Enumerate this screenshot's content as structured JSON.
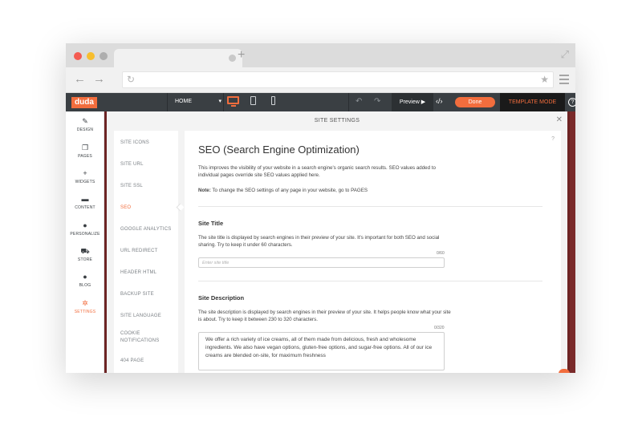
{
  "browser": {
    "window_dots": [
      "#f45b51",
      "#f7be2e",
      "#aeaeae"
    ],
    "new_tab_label": "+",
    "icons": [
      "back-arrow-icon",
      "forward-arrow-icon",
      "reload-icon",
      "star-icon",
      "menu-icon",
      "expand-icon"
    ]
  },
  "toolbar": {
    "logo": "duda",
    "page_select": "HOME",
    "preview_label": "Preview ▶",
    "done_label": "Done",
    "template_mode_label": "TEMPLATE MODE",
    "help_label": "?",
    "accent": "#f26d3d"
  },
  "sidebar": {
    "items": [
      {
        "label": "DESIGN",
        "icon": "brush-icon",
        "glyph": "✎"
      },
      {
        "label": "PAGES",
        "icon": "pages-icon",
        "glyph": "❐"
      },
      {
        "label": "WIDGETS",
        "icon": "plus-icon",
        "glyph": "+"
      },
      {
        "label": "CONTENT",
        "icon": "folder-icon",
        "glyph": "▬"
      },
      {
        "label": "PERSONALIZE",
        "icon": "person-icon",
        "glyph": "●"
      },
      {
        "label": "STORE",
        "icon": "cart-icon",
        "glyph": "⛟"
      },
      {
        "label": "BLOG",
        "icon": "chat-icon",
        "glyph": "●"
      },
      {
        "label": "SETTINGS",
        "icon": "gear-icon",
        "glyph": "✲",
        "active": true
      }
    ]
  },
  "modal": {
    "title": "SITE SETTINGS",
    "close_glyph": "✕",
    "help_glyph": "?",
    "menu": [
      {
        "label": "SITE ICONS"
      },
      {
        "label": "SITE URL"
      },
      {
        "label": "SITE SSL"
      },
      {
        "label": "SEO",
        "active": true
      },
      {
        "label": "GOOGLE ANALYTICS"
      },
      {
        "label": "URL REDIRECT"
      },
      {
        "label": "HEADER HTML"
      },
      {
        "label": "BACKUP SITE"
      },
      {
        "label": "SITE LANGUAGE"
      },
      {
        "label": "COOKIE NOTIFICATIONS"
      },
      {
        "label": "404 PAGE"
      }
    ]
  },
  "seo": {
    "heading": "SEO (Search Engine Optimization)",
    "intro": "This improves the visibility of your website in a search engine's organic search results. SEO values added to individual pages override site SEO values applied here.",
    "note_label": "Note:",
    "note_text": " To change the SEO settings of any page in your website, go to PAGES",
    "site_title": {
      "heading": "Site Title",
      "description": "The site title is displayed by search engines in their preview of your site. It's important for both SEO and social sharing. Try to keep it under 60 characters.",
      "counter": "0/60",
      "value": "",
      "placeholder": "Enter site title"
    },
    "site_description": {
      "heading": "Site Description",
      "description": "The site description is displayed by search engines in their preview of your site. It helps people know what your site is about. Try to keep it between 230 to 320 characters.",
      "counter": "0/320",
      "value": "We offer a rich variety of ice creams, all of them made from delicious, fresh and wholesome ingredients. We also have vegan options, gluten-free options, and sugar-free options. All of our ice creams are blended on-site, for maximum freshness"
    }
  }
}
